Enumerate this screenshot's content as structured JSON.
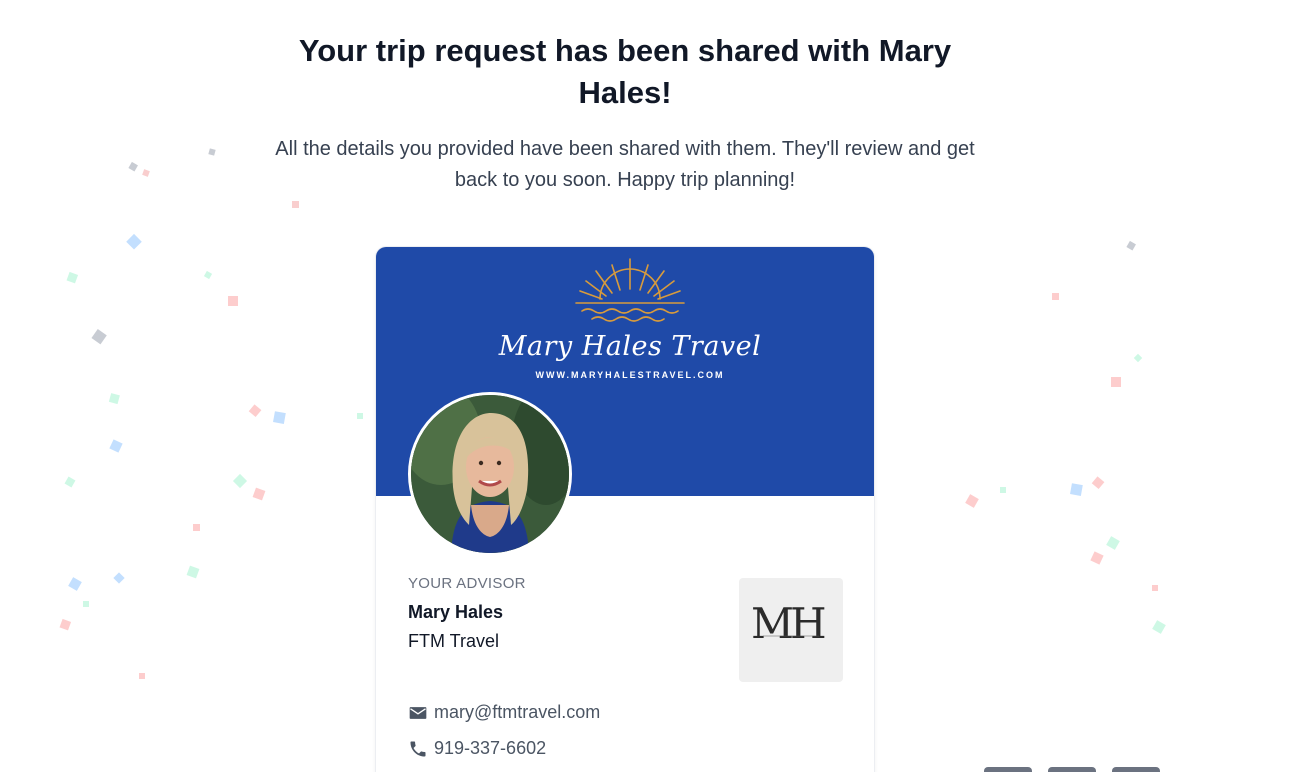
{
  "heading": "Your trip request has been shared with Mary Hales!",
  "subtext": "All the details you provided have been shared with them. They'll review and get back to you soon. Happy trip planning!",
  "card": {
    "brand_name": "Mary Hales Travel",
    "brand_url": "WWW.MARYHALESTRAVEL.COM",
    "advisor_label": "YOUR ADVISOR",
    "advisor_name": "Mary Hales",
    "advisor_company": "FTM Travel",
    "company_logo_text": "MH",
    "email": "mary@ftmtravel.com",
    "phone": "919-337-6602"
  },
  "colors": {
    "banner": "#1f4aa8",
    "heading": "#111827",
    "muted": "#6b7280"
  },
  "icons": [
    "sun-logo-icon",
    "email-icon",
    "phone-icon"
  ]
}
